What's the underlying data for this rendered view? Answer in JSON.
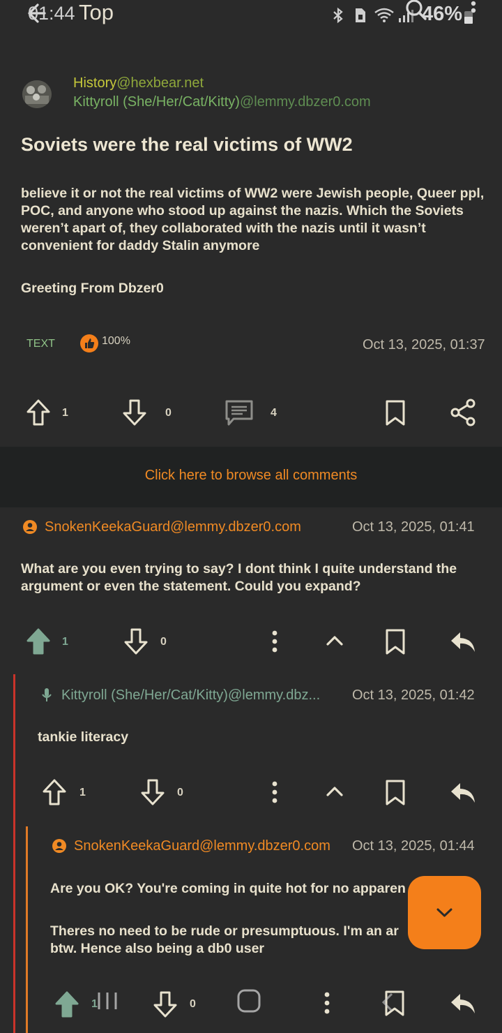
{
  "status_bar": {
    "time": "01:44",
    "battery": "46%"
  },
  "top_bar": {
    "title": "Top"
  },
  "post": {
    "community_name": "History",
    "community_instance": "@hexbear.net",
    "author_name": "Kittyroll (She/Her/Cat/Kitty)",
    "author_instance": "@lemmy.dbzer0.com",
    "title": "Soviets were the real victims of WW2",
    "body": "believe it or not the real victims of WW2 were Jewish people, Queer ppl, POC, and anyone who stood up against the nazis. Which the Soviets weren’t apart of, they collaborated with the nazis until it wasn’t convenient for daddy Stalin anymore",
    "signature": "Greeting From Dbzer0",
    "type": "TEXT",
    "upvote_ratio": "100%",
    "date": "Oct 13, 2025, 01:37",
    "upvotes": "1",
    "downvotes": "0",
    "comments": "4"
  },
  "browse_all": "Click here to browse all comments",
  "comments": [
    {
      "user": "SnokenKeekaGuard@lemmy.dbzer0.com",
      "date": "Oct 13, 2025, 01:41",
      "text": "What are you even trying to say? I dont think I quite understand the argument or even the statement. Could you expand?",
      "upvotes": "1",
      "downvotes": "0"
    },
    {
      "user": "Kittyroll (She/Her/Cat/Kitty)@lemmy.dbz...",
      "date": "Oct 13, 2025, 01:42",
      "text": "tankie literacy",
      "upvotes": "1",
      "downvotes": "0"
    },
    {
      "user": "SnokenKeekaGuard@lemmy.dbzer0.com",
      "date": "Oct 13, 2025, 01:44",
      "text_1": "Are you OK? You're coming in quite hot for no apparen",
      "text_2": "Theres no need to be rude or presumptuous. I'm an ar",
      "text_3": "btw. Hence also being a db0 user",
      "upvotes": "1",
      "downvotes": "0"
    }
  ],
  "colors": {
    "background": "#2a2a2a",
    "accent": "#f47f1a",
    "thread_level_1": "#c9332a",
    "thread_level_2": "#e07a26",
    "upvoted": "#7fa893"
  }
}
